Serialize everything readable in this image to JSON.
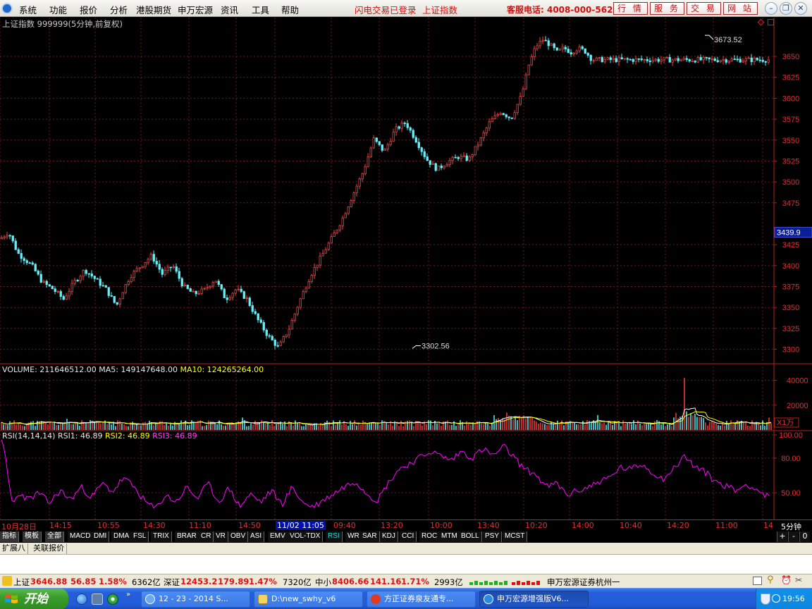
{
  "menubar": {
    "items": [
      "系统",
      "功能",
      "报价",
      "分析",
      "港股期货",
      "申万宏源",
      "资讯",
      "工具",
      "帮助"
    ],
    "status": "闪电交易已登录",
    "index": "上证指数",
    "hotline": "客服电话: 4008-000-562",
    "services": [
      "行 情",
      "服 务",
      "交 易",
      "网 站"
    ]
  },
  "chart_header": "上证指数 999999(5分钟,前复权)",
  "chart_data": [
    {
      "type": "candlestick",
      "title": "上证指数 999999(5分钟,前复权)",
      "y_ticks": [
        3650,
        3625,
        3600,
        3575,
        3550,
        3525,
        3500,
        3475,
        3425,
        3400,
        3375,
        3350,
        3325,
        3300
      ],
      "current_label": "3439.9",
      "annotations": [
        {
          "text": "3673.52",
          "role": "high",
          "value": 3673.52
        },
        {
          "text": "3302.56",
          "role": "low",
          "value": 3302.56
        }
      ],
      "open": 3432,
      "close": 3646.88,
      "high": 3673.52,
      "low": 3302.56,
      "ylim": [
        3287,
        3693
      ],
      "grid": true,
      "x_ticks": [
        "10月28日",
        "14:15",
        "10:55",
        "14:30",
        "11:10",
        "14:50",
        "11/02 11:05",
        "09:40",
        "13:20",
        "10:00",
        "13:40",
        "10:20",
        "14:00",
        "10:40",
        "14:20",
        "11:00",
        "14"
      ],
      "price_path": [
        [
          0,
          3432
        ],
        [
          12,
          3440
        ],
        [
          25,
          3415
        ],
        [
          45,
          3400
        ],
        [
          60,
          3380
        ],
        [
          75,
          3372
        ],
        [
          90,
          3360
        ],
        [
          105,
          3380
        ],
        [
          120,
          3395
        ],
        [
          135,
          3384
        ],
        [
          150,
          3372
        ],
        [
          165,
          3352
        ],
        [
          175,
          3372
        ],
        [
          185,
          3388
        ],
        [
          200,
          3400
        ],
        [
          215,
          3412
        ],
        [
          230,
          3390
        ],
        [
          245,
          3400
        ],
        [
          260,
          3375
        ],
        [
          275,
          3366
        ],
        [
          290,
          3371
        ],
        [
          305,
          3384
        ],
        [
          320,
          3360
        ],
        [
          335,
          3372
        ],
        [
          350,
          3360
        ],
        [
          365,
          3336
        ],
        [
          380,
          3316
        ],
        [
          395,
          3302
        ],
        [
          410,
          3325
        ],
        [
          425,
          3358
        ],
        [
          440,
          3388
        ],
        [
          455,
          3410
        ],
        [
          470,
          3432
        ],
        [
          485,
          3455
        ],
        [
          500,
          3484
        ],
        [
          515,
          3512
        ],
        [
          530,
          3551
        ],
        [
          545,
          3536
        ],
        [
          560,
          3562
        ],
        [
          575,
          3571
        ],
        [
          590,
          3550
        ],
        [
          605,
          3527
        ],
        [
          620,
          3515
        ],
        [
          635,
          3524
        ],
        [
          650,
          3530
        ],
        [
          665,
          3527
        ],
        [
          680,
          3548
        ],
        [
          695,
          3572
        ],
        [
          710,
          3584
        ],
        [
          725,
          3576
        ],
        [
          740,
          3604
        ],
        [
          750,
          3640
        ],
        [
          760,
          3662
        ],
        [
          770,
          3670
        ],
        [
          780,
          3664
        ],
        [
          790,
          3655
        ],
        [
          800,
          3660
        ],
        [
          810,
          3655
        ],
        [
          820,
          3660
        ],
        [
          830,
          3656
        ],
        [
          840,
          3646
        ]
      ]
    },
    {
      "type": "bar",
      "title": "VOLUME",
      "series": [
        {
          "name": "VOLUME",
          "value": 211646512.0
        },
        {
          "name": "MA5",
          "value": 149147648.0
        },
        {
          "name": "MA10",
          "value": 124265264.0
        }
      ],
      "y_ticks": [
        40000,
        20000
      ],
      "unit": "X1万"
    },
    {
      "type": "line",
      "title": "RSI(14,14,14)",
      "series": [
        {
          "name": "RSI1",
          "value": 46.89
        },
        {
          "name": "RSI2",
          "value": 46.89
        },
        {
          "name": "RSI3",
          "value": 46.89
        }
      ],
      "y_ticks": [
        100.0,
        80.0,
        50.0
      ],
      "ylim": [
        30,
        100
      ],
      "rsi_path": [
        [
          0,
          100
        ],
        [
          6,
          88
        ],
        [
          12,
          60
        ],
        [
          18,
          40
        ],
        [
          28,
          50
        ],
        [
          40,
          44
        ],
        [
          55,
          50
        ],
        [
          70,
          41
        ],
        [
          85,
          52
        ],
        [
          100,
          44
        ],
        [
          115,
          55
        ],
        [
          130,
          46
        ],
        [
          145,
          58
        ],
        [
          160,
          51
        ],
        [
          175,
          63
        ],
        [
          190,
          55
        ],
        [
          205,
          43
        ],
        [
          220,
          36
        ],
        [
          235,
          48
        ],
        [
          250,
          42
        ],
        [
          265,
          55
        ],
        [
          280,
          45
        ],
        [
          295,
          58
        ],
        [
          310,
          42
        ],
        [
          325,
          54
        ],
        [
          340,
          38
        ],
        [
          355,
          49
        ],
        [
          370,
          42
        ],
        [
          385,
          52
        ],
        [
          400,
          40
        ],
        [
          415,
          55
        ],
        [
          430,
          41
        ],
        [
          445,
          38
        ],
        [
          460,
          44
        ],
        [
          475,
          50
        ],
        [
          490,
          56
        ],
        [
          505,
          60
        ],
        [
          520,
          50
        ],
        [
          535,
          43
        ],
        [
          550,
          58
        ],
        [
          565,
          70
        ],
        [
          580,
          75
        ],
        [
          595,
          80
        ],
        [
          610,
          86
        ],
        [
          625,
          82
        ],
        [
          640,
          78
        ],
        [
          655,
          86
        ],
        [
          670,
          80
        ],
        [
          685,
          88
        ],
        [
          700,
          82
        ],
        [
          715,
          90
        ],
        [
          730,
          80
        ],
        [
          745,
          70
        ],
        [
          760,
          66
        ],
        [
          775,
          55
        ],
        [
          790,
          58
        ],
        [
          805,
          48
        ],
        [
          820,
          52
        ],
        [
          835,
          55
        ],
        [
          850,
          60
        ],
        [
          865,
          63
        ],
        [
          880,
          72
        ],
        [
          895,
          70
        ],
        [
          910,
          75
        ],
        [
          925,
          68
        ],
        [
          940,
          62
        ],
        [
          955,
          70
        ],
        [
          970,
          82
        ],
        [
          985,
          73
        ],
        [
          1000,
          68
        ],
        [
          1015,
          60
        ],
        [
          1030,
          56
        ],
        [
          1045,
          52
        ],
        [
          1060,
          58
        ],
        [
          1075,
          52
        ],
        [
          1088,
          47
        ]
      ]
    }
  ],
  "volume_header": {
    "vol_label": "VOLUME: 211646512.00",
    "ma5_label": "MA5: 149147648.00",
    "ma10_label": "MA10: 124265264.00",
    "unit": "X1万"
  },
  "rsi_header": {
    "name": "RSI(14,14,14)",
    "rsi1": "RSI1: 46.89",
    "rsi2": "RSI2: 46.89",
    "rsi3": "RSI3: 46.89"
  },
  "period": "5分钟",
  "indicator_tabs": [
    "指标",
    "模板",
    "全部",
    "MACD",
    "DMI",
    "DMA",
    "FSL",
    "TRIX",
    "BRAR",
    "CR",
    "VR",
    "OBV",
    "ASI",
    "EMV",
    "VOL-TDX",
    "RSI",
    "WR",
    "SAR",
    "KDJ",
    "CCI",
    "ROC",
    "MTM",
    "BOLL",
    "PSY",
    "MCST"
  ],
  "active_indicator": "RSI",
  "ext_tabs": [
    "扩展八",
    "关联报价"
  ],
  "ticker": {
    "sh_name": "上证",
    "sh_value": "3646.88",
    "sh_chg": "56.85",
    "sh_pct": "1.58%",
    "sh_amt": "6362亿",
    "sz_name": "深证",
    "sz_value": "12453.2",
    "sz_chg": "179.89",
    "sz_pct": "1.47%",
    "sz_amt": "7320亿",
    "zx_name": "中小",
    "zx_value": "8406.66",
    "zx_chg": "141.16",
    "zx_pct": "1.71%",
    "zx_amt": "2993亿",
    "broker": "申万宏源证券杭州一"
  },
  "taskbar": {
    "start": "开始",
    "tasks": [
      "12 - 23 - 2014 S...",
      "D:\\new_swhy_v6",
      "方正证券泉友通专...",
      "申万宏源增强版V6..."
    ],
    "clock": "19:56"
  },
  "colors": {
    "up": "#ff3a3a",
    "down": "#54f6ff",
    "ma5": "#ffffff",
    "ma10": "#ffff00",
    "rsi": "#ff00ff",
    "grid": "#6b1a1a",
    "axis": "#b82020"
  }
}
